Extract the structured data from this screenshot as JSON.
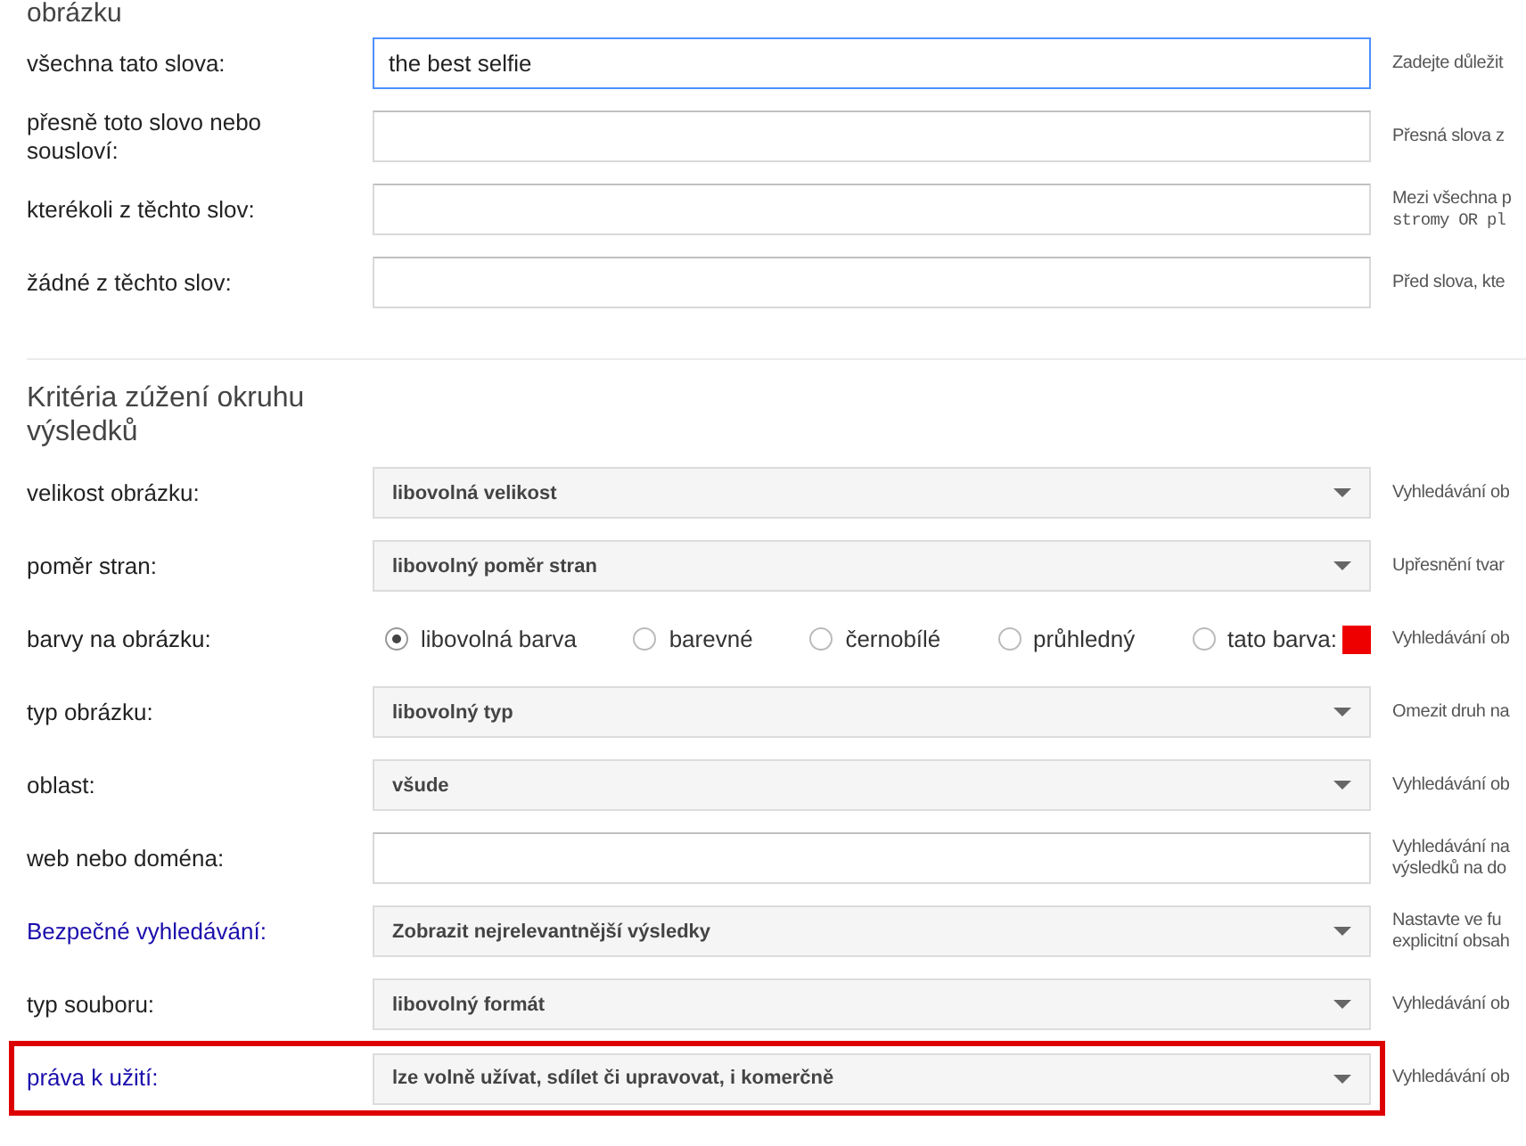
{
  "section_top": {
    "heading": "obrázku",
    "rows": [
      {
        "kind": "text",
        "label": "všechna tato slova:",
        "label_link": false,
        "highlighted": false,
        "value": "the best selfie",
        "focused": true,
        "hint": [
          {
            "kind": "plain",
            "text": "Zadejte důležit"
          }
        ]
      },
      {
        "kind": "text",
        "label": "přesně toto slovo nebo sousloví:",
        "label_link": false,
        "highlighted": false,
        "value": "",
        "focused": false,
        "hint": [
          {
            "kind": "plain",
            "text": "Přesná slova z"
          }
        ]
      },
      {
        "kind": "text",
        "label": "kterékoli z těchto slov:",
        "label_link": false,
        "highlighted": false,
        "value": "",
        "focused": false,
        "hint": [
          {
            "kind": "plain",
            "text": "Mezi všechna p"
          },
          {
            "kind": "code",
            "text": "stromy OR pl"
          }
        ]
      },
      {
        "kind": "text",
        "label": "žádné z těchto slov:",
        "label_link": false,
        "highlighted": false,
        "value": "",
        "focused": false,
        "hint": [
          {
            "kind": "plain",
            "text": "Před slova, kte"
          }
        ]
      }
    ]
  },
  "section_criteria": {
    "heading": "Kritéria zúžení okruhu výsledků",
    "rows": [
      {
        "kind": "select",
        "label": "velikost obrázku:",
        "label_link": false,
        "highlighted": false,
        "value": "libovolná velikost",
        "hint": [
          {
            "kind": "plain",
            "text": "Vyhledávání ob"
          }
        ]
      },
      {
        "kind": "select",
        "label": "poměr stran:",
        "label_link": false,
        "highlighted": false,
        "value": "libovolný poměr stran",
        "hint": [
          {
            "kind": "plain",
            "text": "Upřesnění tvar"
          }
        ]
      },
      {
        "kind": "radio",
        "label": "barvy na obrázku:",
        "label_link": false,
        "highlighted": false,
        "options": [
          {
            "label": "libovolná barva",
            "selected": true
          },
          {
            "label": "barevné",
            "selected": false
          },
          {
            "label": "černobílé",
            "selected": false
          },
          {
            "label": "průhledný",
            "selected": false
          },
          {
            "label": "tato barva:",
            "selected": false,
            "color": "#ee0000"
          }
        ],
        "hint": [
          {
            "kind": "plain",
            "text": "Vyhledávání ob"
          }
        ]
      },
      {
        "kind": "select",
        "label": "typ obrázku:",
        "label_link": false,
        "highlighted": false,
        "value": "libovolný typ",
        "hint": [
          {
            "kind": "plain",
            "text": "Omezit druh na"
          }
        ]
      },
      {
        "kind": "select",
        "label": "oblast:",
        "label_link": false,
        "highlighted": false,
        "value": "všude",
        "hint": [
          {
            "kind": "plain",
            "text": "Vyhledávání ob"
          }
        ]
      },
      {
        "kind": "text",
        "label": "web nebo doména:",
        "label_link": false,
        "highlighted": false,
        "value": "",
        "focused": false,
        "hint": [
          {
            "kind": "plain",
            "text": "Vyhledávání na"
          },
          {
            "kind": "plain",
            "text": "výsledků na do"
          }
        ]
      },
      {
        "kind": "select",
        "label": "Bezpečné vyhledávání:",
        "label_link": true,
        "highlighted": false,
        "value": "Zobrazit nejrelevantnější výsledky",
        "hint": [
          {
            "kind": "plain",
            "text": "Nastavte ve fu"
          },
          {
            "kind": "plain",
            "text": "explicitní obsah"
          }
        ]
      },
      {
        "kind": "select",
        "label": "typ souboru:",
        "label_link": false,
        "highlighted": false,
        "value": "libovolný formát",
        "hint": [
          {
            "kind": "plain",
            "text": "Vyhledávání ob"
          }
        ]
      },
      {
        "kind": "select",
        "label": "práva k užití:",
        "label_link": true,
        "highlighted": true,
        "value": "lze volně užívat, sdílet či upravovat, i komerčně",
        "hint": [
          {
            "kind": "plain",
            "text": "Vyhledávání ob"
          }
        ]
      }
    ]
  }
}
